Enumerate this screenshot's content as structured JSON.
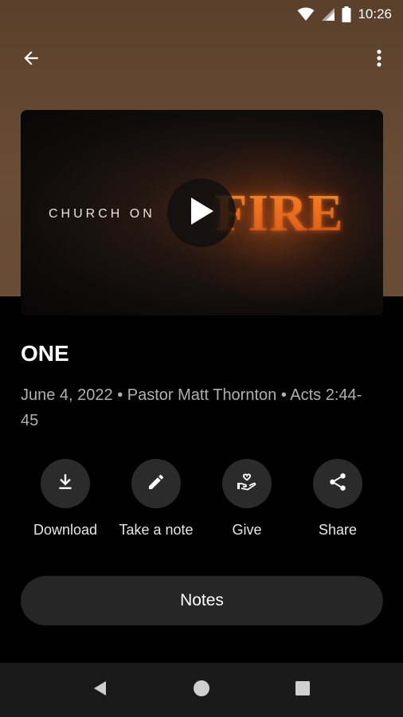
{
  "status_bar": {
    "time": "10:26",
    "icons": [
      "wifi-icon",
      "signal-icon",
      "battery-icon"
    ]
  },
  "app_bar": {
    "back_icon": "arrow-back-icon",
    "more_icon": "more-vert-icon"
  },
  "video": {
    "artwork_text_1": "CHURCH ON",
    "artwork_text_2": "FIRE",
    "play_icon": "play-icon"
  },
  "sermon": {
    "title": "ONE",
    "meta": "June 4, 2022 • Pastor Matt Thornton • Acts 2:44-45"
  },
  "actions": [
    {
      "label": "Download",
      "icon": "download-icon"
    },
    {
      "label": "Take a note",
      "icon": "pencil-icon"
    },
    {
      "label": "Give",
      "icon": "give-hand-heart-icon"
    },
    {
      "label": "Share",
      "icon": "share-icon"
    }
  ],
  "notes_button": {
    "label": "Notes"
  },
  "nav_bar": {
    "icons": [
      "back-triangle-icon",
      "home-circle-icon",
      "recents-square-icon"
    ]
  },
  "colors": {
    "hero_brown": "#6b4c34",
    "background": "#000000",
    "button_bg": "#2b2b2b",
    "meta_gray": "#b0b0b0"
  }
}
